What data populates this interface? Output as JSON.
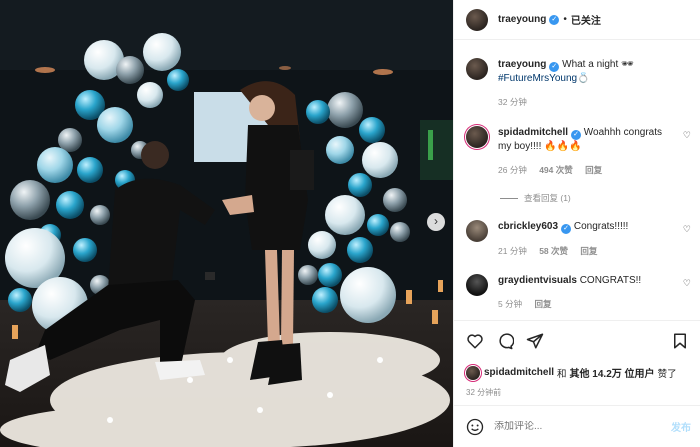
{
  "photo": {
    "next_icon": "chevron-right-icon"
  },
  "header": {
    "username": "traeyoung",
    "verified_icon": "verified-badge-icon",
    "separator": "•",
    "follow_status": "已关注"
  },
  "caption": {
    "username": "traeyoung",
    "text": "What a night",
    "emoji": "🕶",
    "hashtag": "#FutureMrsYoung",
    "ring_emoji": "💍",
    "time": "32 分钟"
  },
  "comments": [
    {
      "username": "spidadmitchell",
      "text_line1": "Woahhh congrats",
      "text_line2": "my boy!!!! 🔥🔥🔥",
      "time": "26 分钟",
      "likes": "494 次赞",
      "reply": "回复",
      "view_replies": "查看回复 (1)"
    },
    {
      "username": "cbrickley603",
      "text": "Congrats!!!!!",
      "time": "21 分钟",
      "likes": "58 次赞",
      "reply": "回复"
    },
    {
      "username": "graydientvisuals",
      "text": "CONGRATS!!",
      "time": "5 分钟",
      "reply": "回复"
    }
  ],
  "likes": {
    "user": "spidadmitchell",
    "and": "和",
    "others": "其他 14.2万 位用户",
    "suffix": "赞了"
  },
  "post_time": "32 分钟前",
  "add_comment": {
    "placeholder": "添加评论...",
    "post_label": "发布"
  },
  "colors": {
    "link": "#00376b",
    "verified": "#3897f0",
    "muted": "#8e8e8e",
    "post_disabled": "#b2dffc"
  }
}
